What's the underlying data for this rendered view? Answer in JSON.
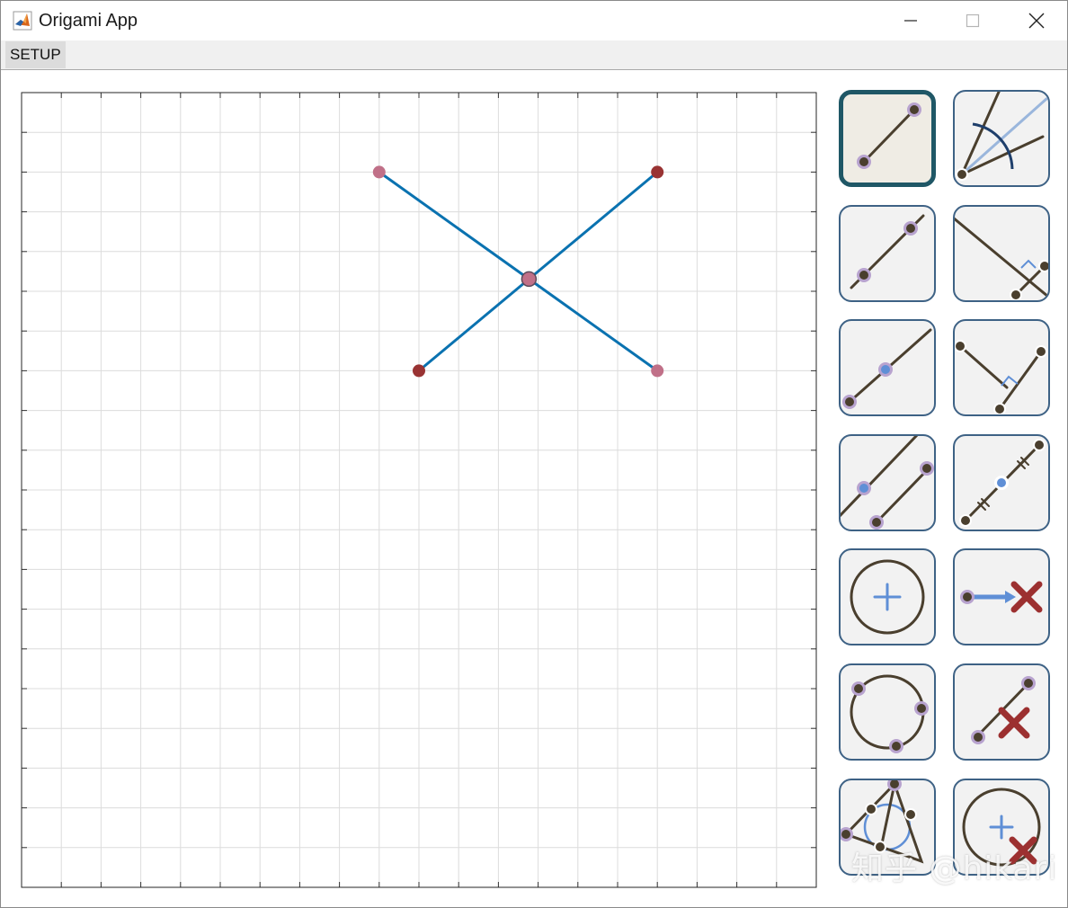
{
  "window": {
    "title": "Origami App",
    "controls": [
      "minimize",
      "maximize",
      "close"
    ]
  },
  "menu": {
    "items": [
      {
        "label": "SETUP"
      }
    ]
  },
  "canvas": {
    "grid_cols": 20,
    "grid_rows": 20,
    "line_color": "#0a72b0",
    "points": [
      {
        "id": "p1",
        "col": 9,
        "row": 2,
        "color": "#c07088"
      },
      {
        "id": "p2",
        "col": 16,
        "row": 2,
        "color": "#993333"
      },
      {
        "id": "p3",
        "col": 10,
        "row": 7,
        "color": "#993333"
      },
      {
        "id": "p4",
        "col": 16,
        "row": 7,
        "color": "#c07088"
      }
    ],
    "intersection_color": "#c07088",
    "lines": [
      {
        "from": "p1",
        "to": "p4"
      },
      {
        "from": "p3",
        "to": "p2"
      }
    ]
  },
  "tools": [
    {
      "name": "segment-tool",
      "icon": "segment-two-points-icon",
      "selected": true
    },
    {
      "name": "angle-bisector-tool",
      "icon": "angle-bisector-icon",
      "selected": false
    },
    {
      "name": "line-through-points-tool",
      "icon": "line-through-points-icon",
      "selected": false
    },
    {
      "name": "perpendicular-tool",
      "icon": "perpendicular-line-icon",
      "selected": false
    },
    {
      "name": "point-on-line-tool",
      "icon": "point-on-line-icon",
      "selected": false
    },
    {
      "name": "perpendicular-foot-tool",
      "icon": "perpendicular-foot-icon",
      "selected": false
    },
    {
      "name": "parallel-line-tool",
      "icon": "parallel-line-icon",
      "selected": false
    },
    {
      "name": "midpoint-tool",
      "icon": "midpoint-icon",
      "selected": false
    },
    {
      "name": "circle-center-tool",
      "icon": "circle-center-icon",
      "selected": false
    },
    {
      "name": "delete-point-tool",
      "icon": "delete-point-icon",
      "selected": false
    },
    {
      "name": "circle-three-points-tool",
      "icon": "circle-three-points-icon",
      "selected": false
    },
    {
      "name": "delete-line-tool",
      "icon": "delete-line-icon",
      "selected": false
    },
    {
      "name": "incircle-tool",
      "icon": "incircle-triangle-icon",
      "selected": false
    },
    {
      "name": "delete-circle-tool",
      "icon": "delete-circle-icon",
      "selected": false
    }
  ],
  "colors": {
    "tool_line": "#4a3f2e",
    "tool_point_fill": "#4a3f2e",
    "tool_point_ring": "#b8a3cf",
    "tool_accent_blue": "#5f8fd6",
    "tool_cross_red": "#9c3030",
    "tool_light_blue": "#9ab6dc"
  },
  "watermark": {
    "text": "知乎 @hikari"
  }
}
